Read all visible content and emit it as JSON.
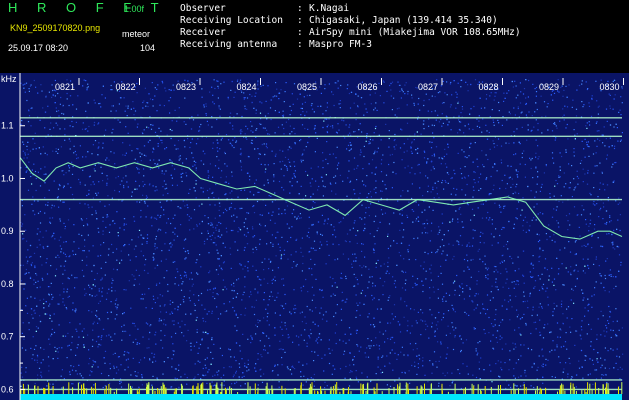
{
  "header": {
    "brand": "H R O F F T",
    "version": "1.00f",
    "filename": "KN9_2509170820.png",
    "datetime": "25.09.17 08:20",
    "mode": "meteor",
    "count": "104",
    "meta": [
      {
        "key": "Observer",
        "value": "K.Nagai"
      },
      {
        "key": "Receiving Location",
        "value": "Chigasaki, Japan (139.414 35.340)"
      },
      {
        "key": "Receiver",
        "value": "AirSpy mini (Miakejima VOR 108.65MHz)"
      },
      {
        "key": "Receiving antenna",
        "value": "Maspro FM-3"
      }
    ]
  },
  "colors": {
    "background": "#0a1466",
    "noise": "#2a5cff",
    "signal": "#b6ffd0",
    "baseline": "#00e6ff",
    "brand": "#2ee85a",
    "filename": "#e6e600"
  },
  "chart_data": {
    "type": "heatmap",
    "ylabel": "kHz",
    "ylim": [
      0.58,
      1.2
    ],
    "yticks": [
      1.1,
      1.0,
      0.9,
      0.8,
      0.7,
      0.6
    ],
    "yticks_minor": [
      0.75,
      0.65
    ],
    "time_ticks": [
      "0821",
      "0822",
      "0823",
      "0824",
      "0825",
      "0826",
      "0827",
      "0828",
      "0829",
      "0830"
    ],
    "time_range": [
      0,
      10
    ],
    "carriers": [
      {
        "name": "",
        "freq": 1.115
      },
      {
        "name": "",
        "freq": 1.08
      },
      {
        "name": "",
        "freq": 0.96
      },
      {
        "name": "",
        "freq": 0.618
      },
      {
        "name": "",
        "freq": 0.6
      }
    ],
    "drift_trace": {
      "t": [
        0.0,
        0.2,
        0.4,
        0.6,
        0.8,
        1.0,
        1.3,
        1.6,
        1.9,
        2.2,
        2.5,
        2.8,
        3.0,
        3.3,
        3.6,
        3.9,
        4.2,
        4.5,
        4.8,
        5.1,
        5.4,
        5.7,
        6.0,
        6.3,
        6.6,
        6.9,
        7.2,
        7.5,
        7.8,
        8.1,
        8.4,
        8.7,
        9.0,
        9.3,
        9.6,
        9.8,
        10.0
      ],
      "f": [
        1.04,
        1.01,
        0.995,
        1.02,
        1.03,
        1.02,
        1.03,
        1.02,
        1.03,
        1.02,
        1.03,
        1.02,
        1.0,
        0.99,
        0.98,
        0.985,
        0.97,
        0.955,
        0.94,
        0.95,
        0.93,
        0.96,
        0.95,
        0.94,
        0.96,
        0.955,
        0.95,
        0.955,
        0.96,
        0.965,
        0.955,
        0.91,
        0.89,
        0.885,
        0.9,
        0.9,
        0.89
      ]
    }
  }
}
